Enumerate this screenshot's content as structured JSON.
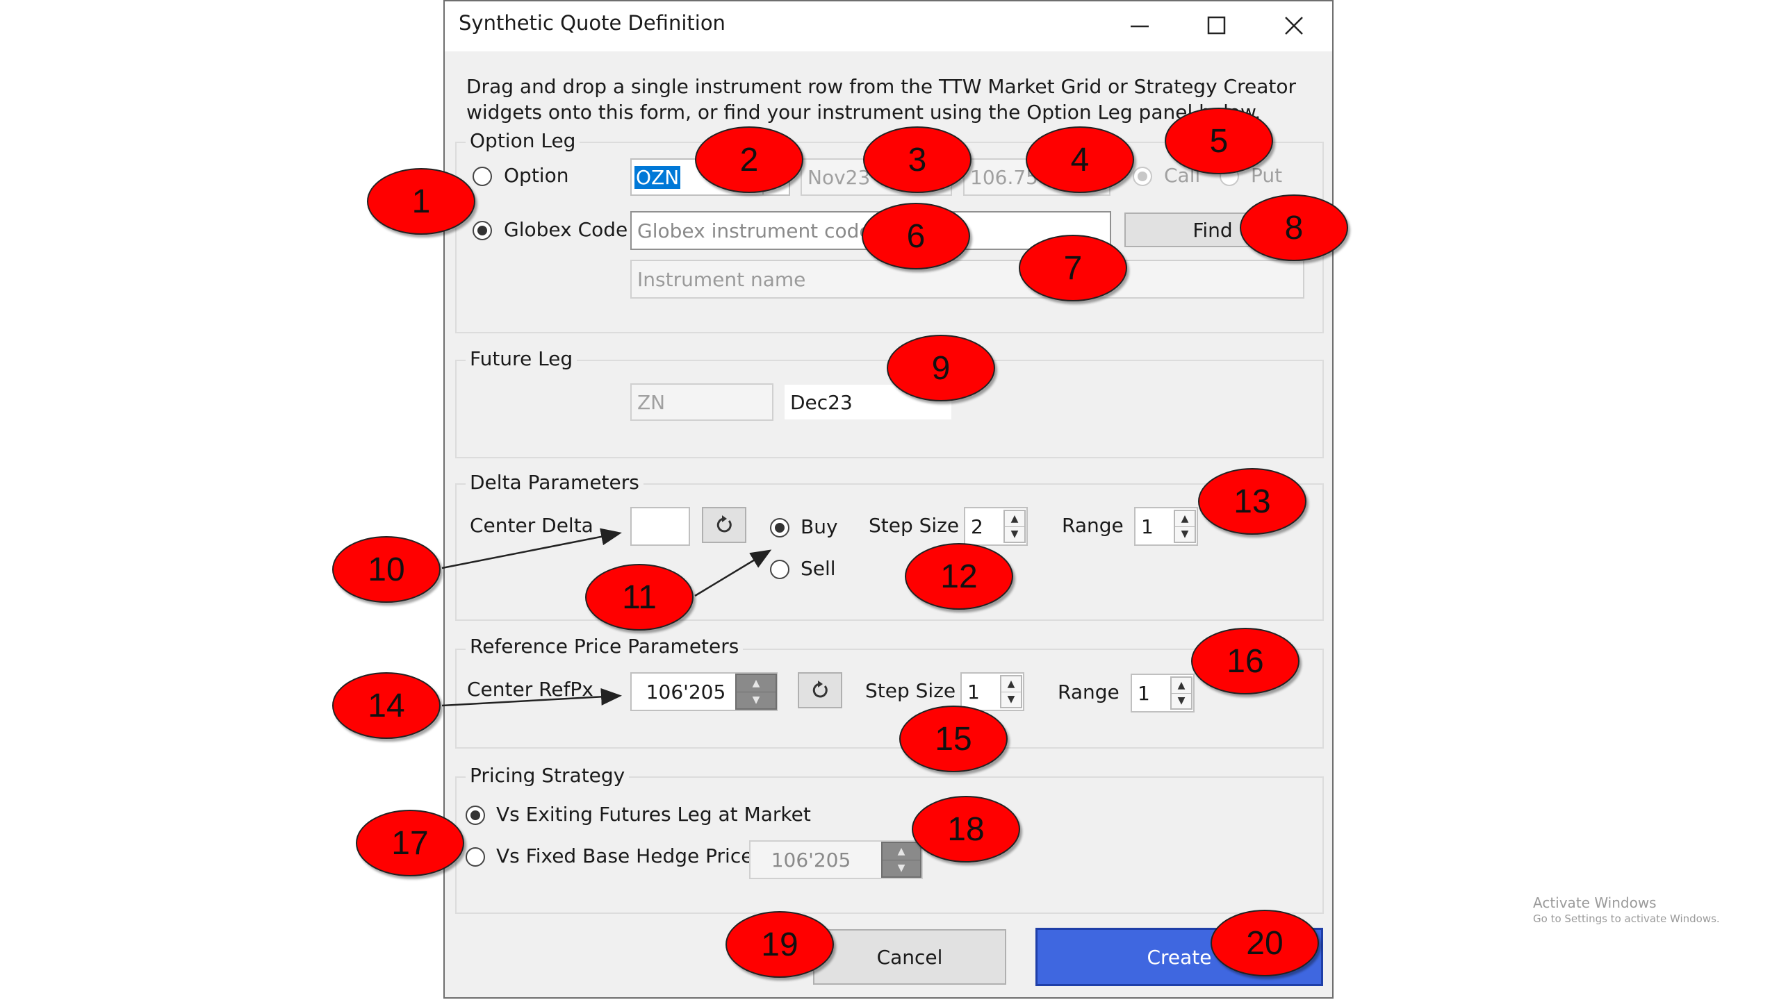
{
  "window": {
    "title": "Synthetic Quote Definition",
    "minimize_icon": "minimize-icon",
    "maximize_icon": "maximize-icon",
    "close_icon": "close-icon"
  },
  "instructions": "Drag and drop a single instrument row from the TTW Market Grid or Strategy Creator widgets onto this form, or find your instrument using the Option Leg panel below.",
  "option_leg": {
    "legend": "Option Leg",
    "option_radio_label": "Option",
    "product_value": "OZN",
    "expiry_value": "Nov23",
    "strike_value": "106.75",
    "call_label": "Call",
    "put_label": "Put",
    "globex_radio_label": "Globex Code",
    "globex_placeholder": "Globex instrument code",
    "find_label": "Find",
    "instrument_name_placeholder": "Instrument name"
  },
  "future_leg": {
    "legend": "Future Leg",
    "product_value": "ZN",
    "expiry_value": "Dec23"
  },
  "delta_params": {
    "legend": "Delta Parameters",
    "center_delta_label": "Center Delta",
    "center_delta_value": "",
    "buy_label": "Buy",
    "sell_label": "Sell",
    "step_size_label": "Step Size",
    "step_size_value": "2",
    "range_label": "Range",
    "range_value": "1"
  },
  "refprice_params": {
    "legend": "Reference Price Parameters",
    "center_label": "Center RefPx",
    "center_value": "106'205",
    "step_size_label": "Step Size",
    "step_size_value": "1",
    "range_label": "Range",
    "range_value": "1"
  },
  "pricing_strategy": {
    "legend": "Pricing Strategy",
    "option_market_label": "Vs Exiting Futures Leg at Market",
    "option_fixed_label": "Vs Fixed Base Hedge Price",
    "fixed_price_value": "106'205"
  },
  "buttons": {
    "cancel": "Cancel",
    "create": "Create"
  },
  "callouts": [
    "1",
    "2",
    "3",
    "4",
    "5",
    "6",
    "7",
    "8",
    "9",
    "10",
    "11",
    "12",
    "13",
    "14",
    "15",
    "16",
    "17",
    "18",
    "19",
    "20"
  ],
  "watermark": {
    "line1": "Activate Windows",
    "line2": "Go to Settings to activate Windows."
  },
  "colors": {
    "callout": "#ff0000",
    "create_button": "#3f67e0",
    "selection": "#0078d7"
  }
}
